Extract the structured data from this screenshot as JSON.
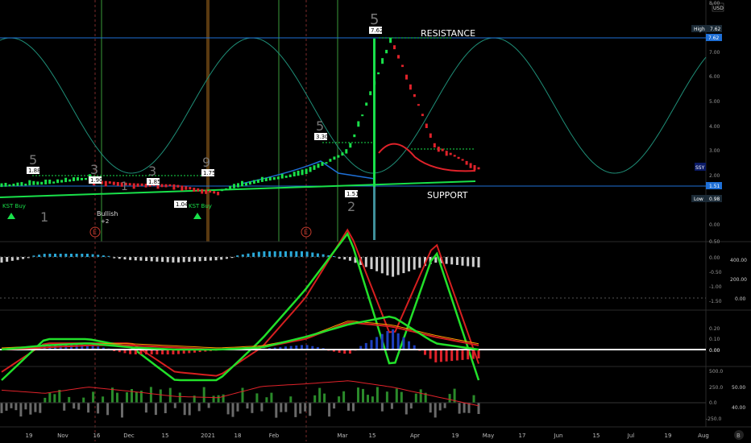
{
  "currency": "USD",
  "price_axis": {
    "ticks": [
      "8.00",
      "7.00",
      "6.00",
      "5.00",
      "4.00",
      "3.00",
      "2.00",
      "1.00",
      "0.00"
    ],
    "high_label": "High",
    "high_value": "7.62",
    "current_value": "7.62",
    "symbol_badge": "SSY",
    "last_value": "1.51",
    "low_label": "Low",
    "low_value": "0.98"
  },
  "annotations": {
    "resistance": "RESISTANCE",
    "support": "SUPPORT",
    "kst_buy_1": "KST Buy",
    "kst_buy_2": "KST Buy",
    "bullish": "Bullish",
    "bullish_sub": "+2",
    "earnings_1": "E",
    "earnings_2": "E"
  },
  "price_tags": [
    {
      "text": "1.88"
    },
    {
      "text": "1.90"
    },
    {
      "text": "1.85"
    },
    {
      "text": "1.75"
    },
    {
      "text": "3.30"
    },
    {
      "text": "7.62"
    },
    {
      "text": "1.51"
    },
    {
      "text": "1.04"
    }
  ],
  "td_counts": [
    {
      "text": "5"
    },
    {
      "text": "3"
    },
    {
      "text": "3"
    },
    {
      "text": "9"
    },
    {
      "text": "5"
    },
    {
      "text": "5"
    },
    {
      "text": "1"
    },
    {
      "text": "1"
    },
    {
      "text": "2"
    }
  ],
  "macd_axis": {
    "ticks": [
      "0.50",
      "0.00",
      "-0.50",
      "-1.00",
      "-1.50"
    ],
    "right_ticks": [
      "400.00",
      "200.00",
      "0.00"
    ]
  },
  "osc_axis": {
    "ticks": [
      "0.20",
      "0.10",
      "0.00"
    ]
  },
  "bottom_axis": {
    "ticks": [
      "500.0",
      "250.0",
      "0.0",
      "-250.0"
    ],
    "right_ticks": [
      "50.00",
      "40.00"
    ]
  },
  "x_axis": {
    "labels": [
      "19",
      "Nov",
      "16",
      "Dec",
      "15",
      "2021",
      "18",
      "Feb",
      "Mar",
      "15",
      "Apr",
      "19",
      "May",
      "17",
      "Jun",
      "15",
      "Jul",
      "19",
      "Aug"
    ]
  },
  "badges": {
    "logo": "B"
  },
  "colors": {
    "candle_up": "#19e04a",
    "candle_down": "#e0222a",
    "macd_fast": "#22e02a",
    "macd_slow": "#d61f1f",
    "signal": "#ff9900",
    "hist_pos": "#2aa9d8",
    "hist_neg": "#cfcfcf",
    "wave": "#1f8f78",
    "level": "#1e6fd6"
  },
  "chart_data": [
    {
      "type": "line",
      "title": "",
      "xlabel": "",
      "ylabel": "",
      "ylim": [
        0,
        8
      ],
      "categories": [
        "Oct 19",
        "Nov",
        "Nov 16",
        "Dec",
        "Dec 15",
        "2021",
        "Jan 18",
        "Feb",
        "Mar",
        "Mar 15",
        "Apr",
        "Apr 19"
      ],
      "series": [
        {
          "name": "",
          "values": [
            1.6,
            1.7,
            1.9,
            1.75,
            1.7,
            1.4,
            1.8,
            2.1,
            3.0,
            7.6,
            3.3,
            2.4
          ]
        }
      ],
      "levels": {
        "resistance": 7.62,
        "support": 1.51,
        "high": 7.62,
        "low": 0.98
      }
    },
    {
      "type": "line",
      "title": "",
      "ylim": [
        -1.5,
        0.5
      ],
      "categories": [
        "Oct 19",
        "Nov",
        "Nov 16",
        "Dec",
        "Dec 15",
        "2021",
        "Jan 18",
        "Feb",
        "Mar",
        "Mar 15",
        "Apr",
        "Apr 19"
      ],
      "series": [
        {
          "name": "",
          "values": [
            -1.5,
            -1.0,
            -1.0,
            -1.1,
            -1.5,
            -1.5,
            -1.0,
            -0.4,
            0.3,
            -1.4,
            0.1,
            -1.5
          ]
        },
        {
          "name": "",
          "values": [
            -1.4,
            -1.05,
            -1.05,
            -1.05,
            -1.4,
            -1.45,
            -1.1,
            -0.5,
            0.35,
            -1.0,
            0.2,
            -1.3
          ]
        }
      ]
    },
    {
      "type": "line",
      "title": "",
      "ylim": [
        0,
        0.2
      ],
      "categories": [
        "Oct 19",
        "Nov",
        "Nov 16",
        "Dec",
        "Dec 15",
        "2021",
        "Jan 18",
        "Feb",
        "Mar",
        "Mar 15",
        "Apr",
        "Apr 19"
      ],
      "series": [
        {
          "name": "",
          "values": [
            0,
            0.02,
            0.03,
            0.01,
            0,
            0,
            0.01,
            0.06,
            0.12,
            0.16,
            0.03,
            0
          ]
        },
        {
          "name": "",
          "values": [
            0,
            0.01,
            0.02,
            0.02,
            0.01,
            0,
            0.01,
            0.05,
            0.13,
            0.11,
            0.06,
            0.02
          ]
        }
      ]
    },
    {
      "type": "line",
      "title": "",
      "ylim": [
        -250,
        500
      ],
      "categories": [
        "Oct 19",
        "Nov",
        "Nov 16",
        "Dec",
        "Dec 15",
        "2021",
        "Jan 18",
        "Feb",
        "Mar",
        "Mar 15",
        "Apr",
        "Apr 19"
      ],
      "series": [
        {
          "name": "",
          "values": [
            200,
            150,
            250,
            180,
            100,
            80,
            260,
            300,
            350,
            250,
            100,
            -50
          ]
        }
      ]
    }
  ]
}
